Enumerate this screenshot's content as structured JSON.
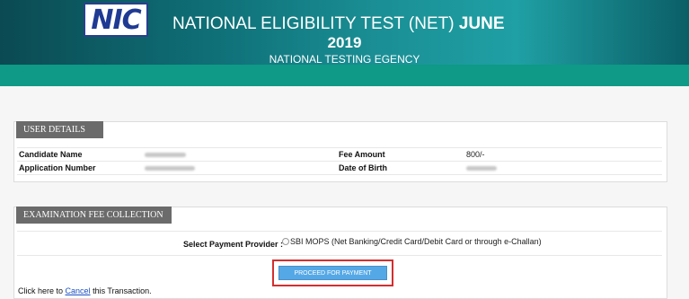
{
  "header": {
    "logo_text": "NIC",
    "title_prefix": "NATIONAL ELIGIBILITY TEST (NET)",
    "title_suffix": "JUNE",
    "year": "2019",
    "agency": "NATIONAL TESTING EGENCY"
  },
  "user_details": {
    "heading": "USER DETAILS",
    "rows": [
      {
        "label": "Candidate Name",
        "right_label": "Fee Amount",
        "right_value": "800/-"
      },
      {
        "label": "Application Number",
        "right_label": "Date of Birth"
      }
    ]
  },
  "exam_fee": {
    "heading": "EXAMINATION FEE COLLECTION",
    "provider_label": "Select Payment Provider :",
    "provider_option": "SBI MOPS (Net Banking/Credit Card/Debit Card or through e-Challan)",
    "pay_button": "PROCEED FOR PAYMENT",
    "cancel_prefix": "Click here to",
    "cancel_link": "Cancel",
    "cancel_suffix": "this Transaction."
  },
  "colors": {
    "banner_dark": "#0b4a52",
    "banner_light": "#1fa0a4",
    "strip": "#0e9a86",
    "button": "#55a8e6",
    "highlight": "#d32f2f",
    "link": "#1a4fc2"
  }
}
